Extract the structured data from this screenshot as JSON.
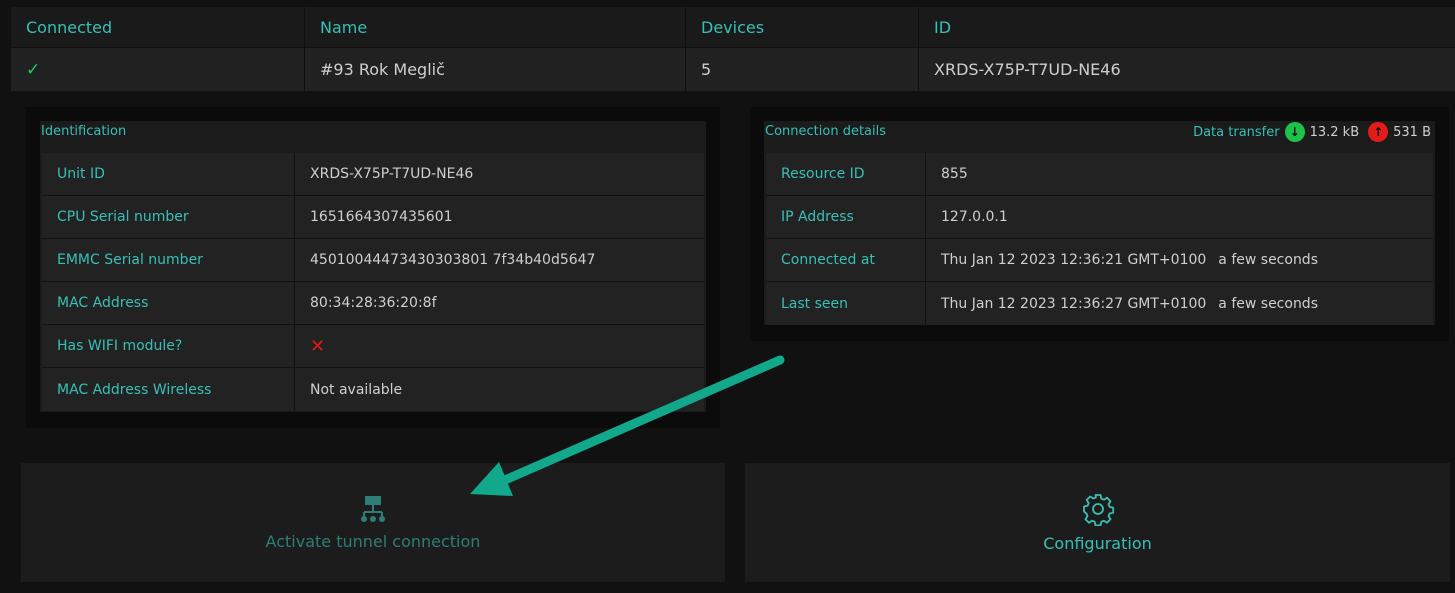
{
  "top_table": {
    "headers": [
      "Connected",
      "Name",
      "Devices",
      "ID"
    ],
    "row": {
      "connected_icon": "check-icon",
      "name": "#93 Rok Meglič",
      "devices": "5",
      "id": "XRDS-X75P-T7UD-NE46"
    }
  },
  "identification": {
    "title": "Identification",
    "rows": [
      {
        "key": "Unit ID",
        "value": "XRDS-X75P-T7UD-NE46"
      },
      {
        "key": "CPU Serial number",
        "value": "1651664307435601"
      },
      {
        "key": "EMMC Serial number",
        "value": "45010044473430303801 7f34b40d5647"
      },
      {
        "key": "MAC Address",
        "value": "80:34:28:36:20:8f"
      },
      {
        "key": "Has WIFI module?",
        "value_icon": "cross-icon"
      },
      {
        "key": "MAC Address Wireless",
        "value": "Not available"
      }
    ]
  },
  "connection": {
    "title": "Connection details",
    "transfer_label": "Data transfer",
    "download": "13.2 kB",
    "upload": "531 B",
    "rows": [
      {
        "key": "Resource ID",
        "value": "855",
        "relative": ""
      },
      {
        "key": "IP Address",
        "value": "127.0.0.1",
        "relative": ""
      },
      {
        "key": "Connected at",
        "value": "Thu Jan 12 2023 12:36:21 GMT+0100",
        "relative": "a few seconds"
      },
      {
        "key": "Last seen",
        "value": "Thu Jan 12 2023 12:36:27 GMT+0100",
        "relative": "a few seconds"
      }
    ]
  },
  "actions": {
    "tunnel_label": "Activate tunnel connection",
    "config_label": "Configuration"
  },
  "colors": {
    "accent": "#37c0b6",
    "annotation_arrow": "#12a88c",
    "success": "#1ec24a",
    "error": "#e01818"
  }
}
